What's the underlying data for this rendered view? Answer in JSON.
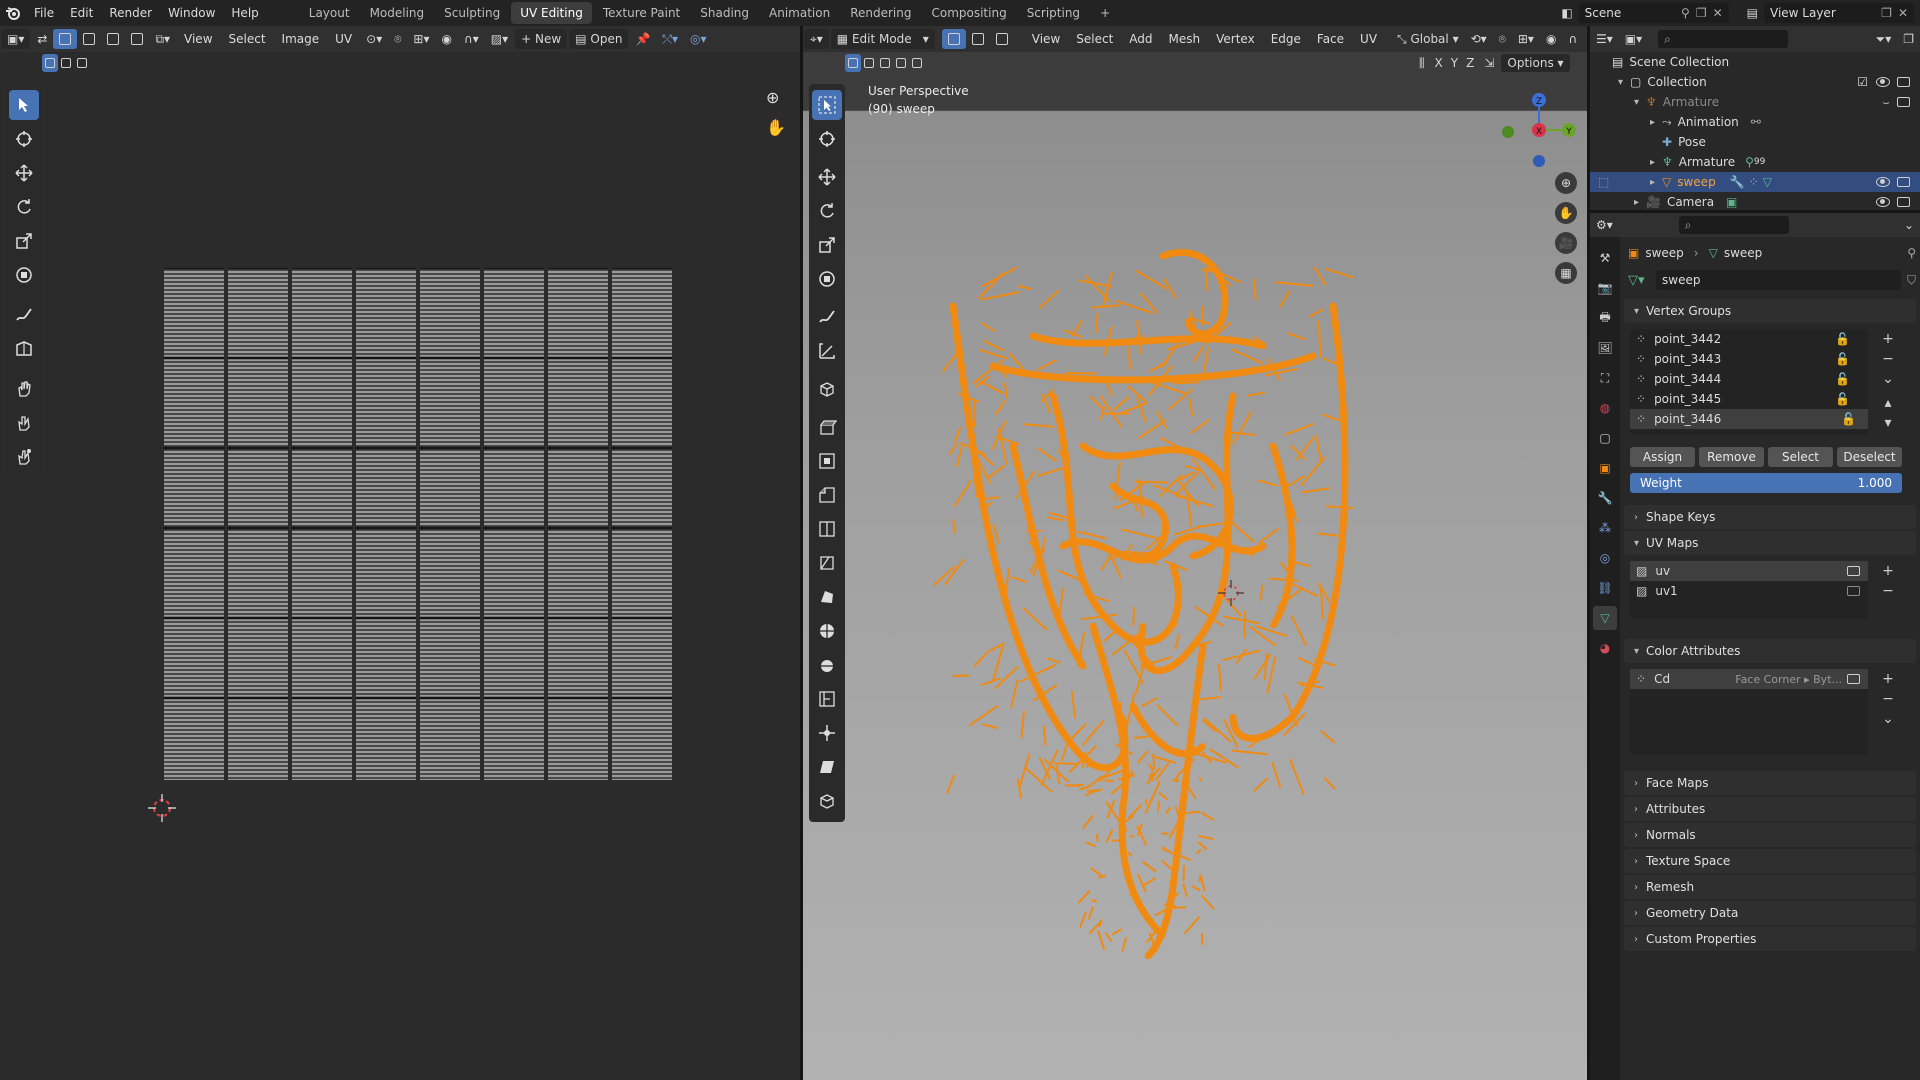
{
  "topbar": {
    "menus": [
      "File",
      "Edit",
      "Render",
      "Window",
      "Help"
    ],
    "workspaces": [
      "Layout",
      "Modeling",
      "Sculpting",
      "UV Editing",
      "Texture Paint",
      "Shading",
      "Animation",
      "Rendering",
      "Compositing",
      "Scripting"
    ],
    "active_workspace": "UV Editing",
    "add_tab": "+",
    "scene": "Scene",
    "view_layer": "View Layer"
  },
  "uv_editor": {
    "menus": [
      "View",
      "Select",
      "Image",
      "UV"
    ],
    "new_label": "New",
    "open_label": "Open"
  },
  "viewport": {
    "mode": "Edit Mode",
    "menus": [
      "View",
      "Select",
      "Add",
      "Mesh",
      "Vertex",
      "Edge",
      "Face",
      "UV"
    ],
    "orientation": "Global",
    "options_label": "Options",
    "axes": [
      "X",
      "Y",
      "Z"
    ],
    "overlay_title": "User Perspective",
    "overlay_object": "(90) sweep",
    "gizmo": {
      "x": "X",
      "y": "Y",
      "z": "Z"
    }
  },
  "outliner": {
    "search_placeholder": "",
    "rows": [
      {
        "label": "Scene Collection"
      },
      {
        "label": "Collection"
      },
      {
        "label": "Armature"
      },
      {
        "label": "Animation"
      },
      {
        "label": "Pose"
      },
      {
        "label": "Armature",
        "badge": "99"
      },
      {
        "label": "sweep"
      },
      {
        "label": "Camera"
      }
    ]
  },
  "properties": {
    "breadcrumb_object": "sweep",
    "breadcrumb_data": "sweep",
    "mesh_name": "sweep",
    "vertex_groups": {
      "title": "Vertex Groups",
      "items": [
        "point_3442",
        "point_3443",
        "point_3444",
        "point_3445",
        "point_3446"
      ],
      "assign": "Assign",
      "remove": "Remove",
      "select": "Select",
      "deselect": "Deselect",
      "weight_label": "Weight",
      "weight_value": "1.000"
    },
    "shape_keys": "Shape Keys",
    "uv_maps": {
      "title": "UV Maps",
      "items": [
        "uv",
        "uv1"
      ]
    },
    "color_attributes": {
      "title": "Color Attributes",
      "item": "Cd",
      "domain": "Face Corner ▸ Byt..."
    },
    "collapsed": [
      "Face Maps",
      "Attributes",
      "Normals",
      "Texture Space",
      "Remesh",
      "Geometry Data",
      "Custom Properties"
    ]
  },
  "colors": {
    "accent": "#4772b3",
    "mesh_orange": "#f08a10",
    "selected_row": "#334d80"
  }
}
